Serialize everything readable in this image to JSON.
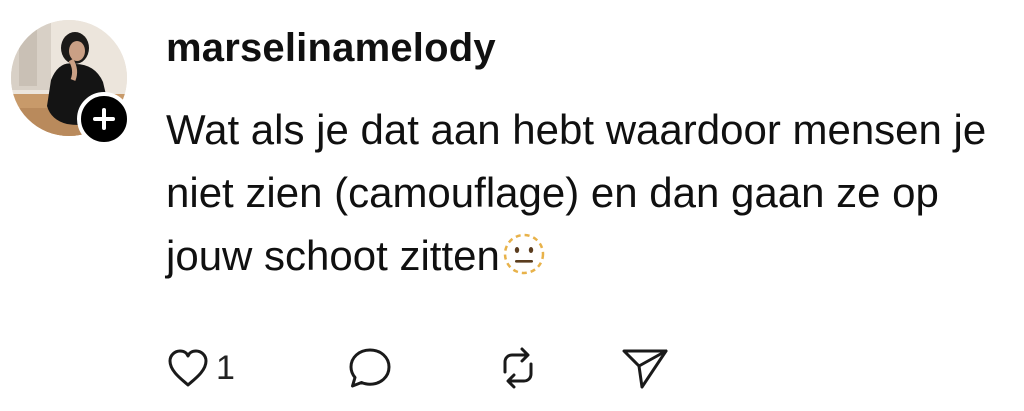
{
  "comment": {
    "username": "marselinamelody",
    "text": "Wat als je dat aan hebt waardoor mensen je niet zien (camouflage) en dan gaan ze op jouw schoot zitten",
    "emoji": "dotted-line-face-emoji"
  },
  "avatar": {
    "follow_icon": "plus-icon"
  },
  "actions": {
    "like_count": "1",
    "like_icon": "heart-icon",
    "reply_icon": "speech-bubble-icon",
    "repost_icon": "repost-icon",
    "share_icon": "send-icon"
  },
  "colors": {
    "text": "#101010",
    "badge": "#000000",
    "emoji": "#e8b24a"
  }
}
